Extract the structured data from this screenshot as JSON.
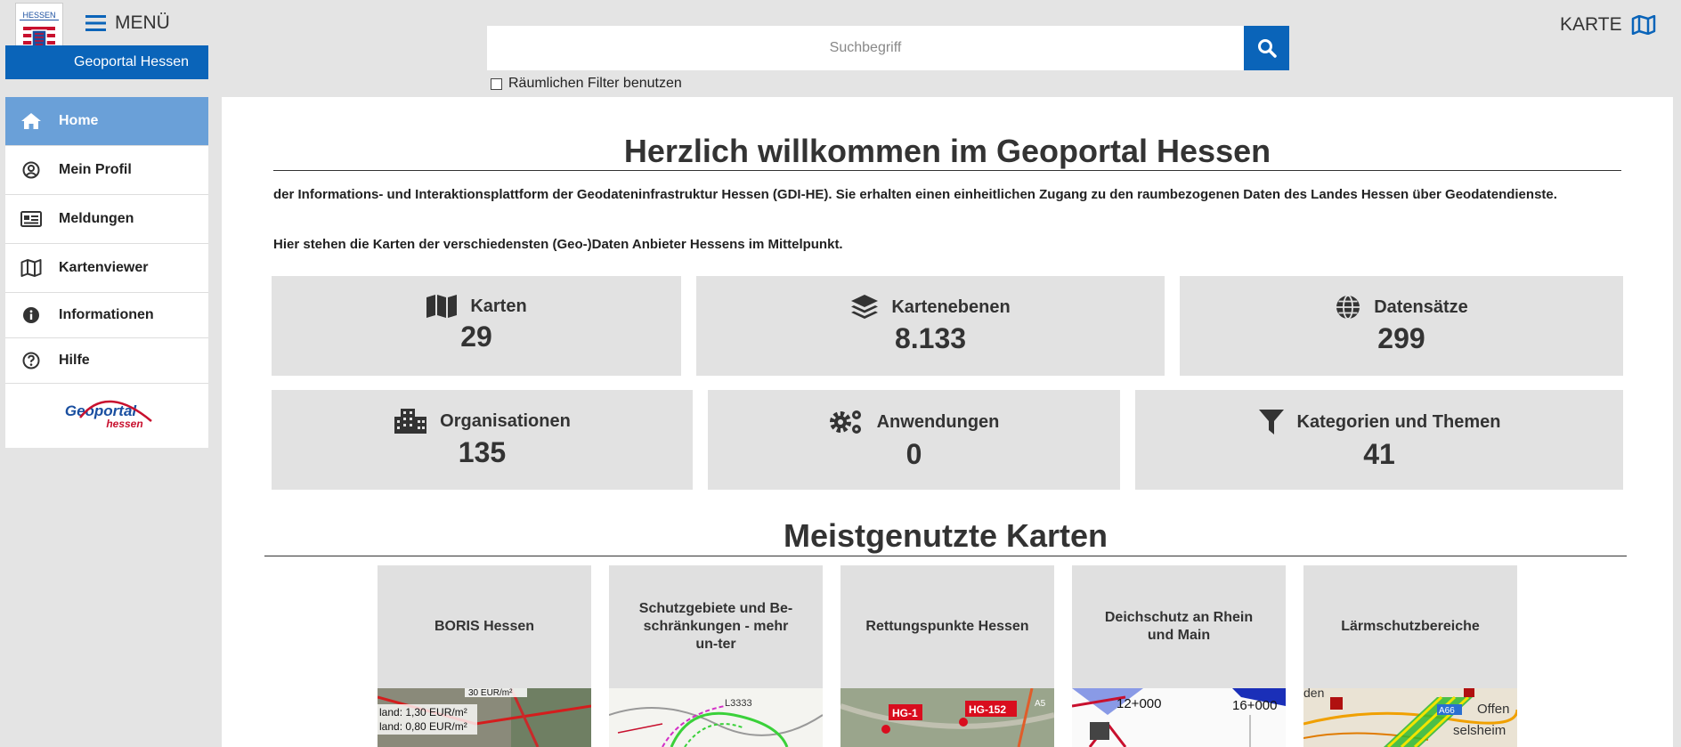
{
  "header": {
    "logo_text": "HESSEN",
    "brand": "Geoportal Hessen",
    "menu_label": "MENÜ",
    "search_placeholder": "Suchbegriff",
    "filter_label": "Räumlichen Filter benutzen",
    "map_label": "KARTE"
  },
  "sidebar": {
    "items": [
      {
        "label": "Home",
        "icon": "home-icon"
      },
      {
        "label": "Mein Profil",
        "icon": "user-circle-icon"
      },
      {
        "label": "Meldungen",
        "icon": "newspaper-icon"
      },
      {
        "label": "Kartenviewer",
        "icon": "map-icon"
      },
      {
        "label": "Informationen",
        "icon": "info-icon"
      },
      {
        "label": "Hilfe",
        "icon": "help-icon"
      }
    ],
    "logo": {
      "line1": "Geoportal",
      "line2": "hessen"
    }
  },
  "main": {
    "title": "Herzlich willkommen im Geoportal Hessen",
    "intro": "der Informations- und Interaktionsplattform der Geodateninfrastruktur Hessen (GDI-HE). Sie erhalten einen einheitlichen Zugang zu den raumbezogenen Daten des Landes Hessen über Geodatendienste.",
    "intro2": "Hier stehen die Karten der verschiedensten (Geo-)Daten Anbieter Hessens im Mittelpunkt.",
    "stats": [
      {
        "label": "Karten",
        "value": "29",
        "icon": "map-icon"
      },
      {
        "label": "Kartenebenen",
        "value": "8.133",
        "icon": "layers-icon"
      },
      {
        "label": "Datensätze",
        "value": "299",
        "icon": "globe-icon"
      },
      {
        "label": "Organisationen",
        "value": "135",
        "icon": "building-icon"
      },
      {
        "label": "Anwendungen",
        "value": "0",
        "icon": "gears-icon"
      },
      {
        "label": "Kategorien und Themen",
        "value": "41",
        "icon": "filter-icon"
      }
    ],
    "section_title": "Meistgenutzte Karten",
    "maps": [
      {
        "title": "BORIS Hessen",
        "thumb_text": [
          "land: 1,30 EUR/m²",
          "land: 0,80 EUR/m²",
          "30 EUR/m²"
        ]
      },
      {
        "title": "Schutzgebiete und Be-schränkungen - mehr un-ter",
        "thumb_text": [
          "L3333"
        ]
      },
      {
        "title": "Rettungspunkte Hessen",
        "thumb_text": [
          "HG-1",
          "HG-152",
          "A5"
        ]
      },
      {
        "title": "Deichschutz an Rhein und Main",
        "thumb_text": [
          "12+000",
          "16+000"
        ]
      },
      {
        "title": "Lärmschutzbereiche",
        "thumb_text": [
          "den",
          "A66",
          "Offen",
          "selsheim"
        ]
      }
    ]
  },
  "colors": {
    "brand_blue": "#0a64b9",
    "active_nav": "#6aa0d8",
    "tile_bg": "#e2e2e2"
  }
}
